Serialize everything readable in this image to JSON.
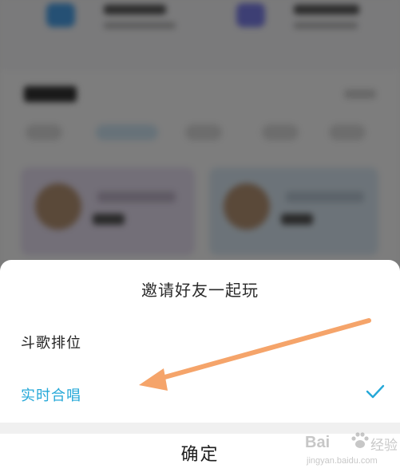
{
  "dialog": {
    "title": "邀请好友一起玩",
    "options": [
      {
        "label": "斗歌排位",
        "selected": false
      },
      {
        "label": "实时合唱",
        "selected": true
      }
    ],
    "confirm_label": "确定"
  },
  "icons": {
    "selected_check": "check-icon"
  },
  "colors": {
    "accent": "#25a8d8",
    "annotation_arrow": "#f5a46a"
  },
  "watermark": {
    "logo": "Bai",
    "logo_suffix": "经验",
    "url": "jingyan.baidu.com"
  }
}
